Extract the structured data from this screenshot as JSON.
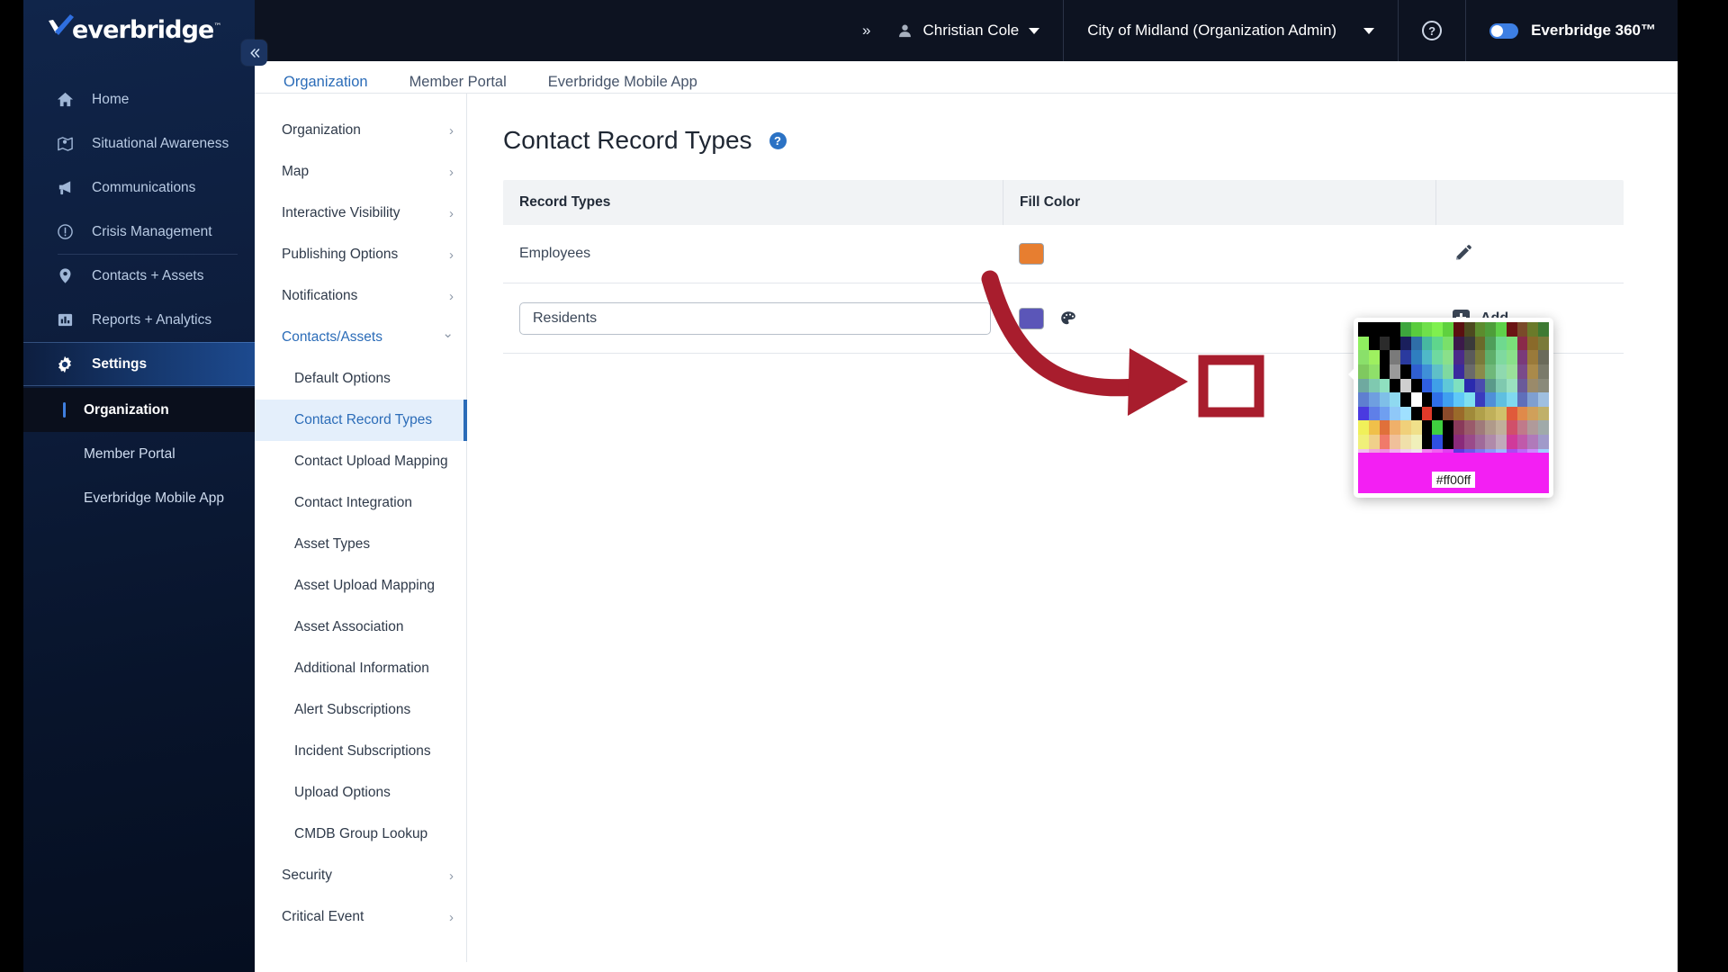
{
  "app": {
    "brand": "everbridge",
    "brand_tm": "™",
    "collapse_icon": "chevron-double-left"
  },
  "topbar": {
    "expand_chevrons": "»",
    "user_name": "Christian Cole",
    "org_name": "City of Midland (Organization Admin)",
    "help_label": "?",
    "product_label": "Everbridge 360™",
    "accent": "#3d7fe3"
  },
  "sidebar": {
    "items": [
      {
        "label": "Home",
        "icon": "home-icon",
        "active": false
      },
      {
        "label": "Situational Awareness",
        "icon": "map-pin-icon",
        "active": false
      },
      {
        "label": "Communications",
        "icon": "megaphone-icon",
        "active": false
      },
      {
        "label": "Crisis Management",
        "icon": "alert-circle-icon",
        "active": false
      },
      {
        "label": "Contacts + Assets",
        "icon": "location-icon",
        "active": false
      },
      {
        "label": "Reports + Analytics",
        "icon": "bar-chart-icon",
        "active": false
      },
      {
        "label": "Settings",
        "icon": "gear-icon",
        "active": true
      }
    ],
    "subitems": [
      {
        "label": "Organization",
        "selected": true
      },
      {
        "label": "Member Portal",
        "selected": false
      },
      {
        "label": "Everbridge Mobile App",
        "selected": false
      }
    ]
  },
  "tabs": [
    {
      "label": "Organization",
      "active": true
    },
    {
      "label": "Member Portal",
      "active": false
    },
    {
      "label": "Everbridge Mobile App",
      "active": false
    }
  ],
  "settings_menu": {
    "groups": [
      {
        "label": "Organization",
        "expandable": true,
        "expanded": false
      },
      {
        "label": "Map",
        "expandable": true,
        "expanded": false
      },
      {
        "label": "Interactive Visibility",
        "expandable": true,
        "expanded": false
      },
      {
        "label": "Publishing Options",
        "expandable": true,
        "expanded": false
      },
      {
        "label": "Notifications",
        "expandable": true,
        "expanded": false
      },
      {
        "label": "Contacts/Assets",
        "expandable": true,
        "expanded": true
      }
    ],
    "contacts_assets_children": [
      {
        "label": "Default Options",
        "selected": false
      },
      {
        "label": "Contact Record Types",
        "selected": true
      },
      {
        "label": "Contact Upload Mapping",
        "selected": false
      },
      {
        "label": "Contact Integration",
        "selected": false
      },
      {
        "label": "Asset Types",
        "selected": false
      },
      {
        "label": "Asset Upload Mapping",
        "selected": false
      },
      {
        "label": "Asset Association",
        "selected": false
      },
      {
        "label": "Additional Information",
        "selected": false
      },
      {
        "label": "Alert Subscriptions",
        "selected": false
      },
      {
        "label": "Incident Subscriptions",
        "selected": false
      },
      {
        "label": "Upload Options",
        "selected": false
      },
      {
        "label": "CMDB Group Lookup",
        "selected": false
      }
    ],
    "tail_groups": [
      {
        "label": "Security",
        "expandable": true,
        "expanded": false
      },
      {
        "label": "Critical Event",
        "expandable": true,
        "expanded": false
      }
    ],
    "chevron_right": "›",
    "chevron_down": "⌄"
  },
  "main": {
    "page_title": "Contact Record Types",
    "help_icon_label": "?",
    "table": {
      "headers": [
        "Record Types",
        "Fill Color",
        ""
      ],
      "rows": [
        {
          "name": "Employees",
          "fill_color": "#e77e30",
          "action": "edit"
        }
      ],
      "new_row": {
        "input_value": "Residents",
        "input_placeholder": "",
        "fill_color": "#5b56b8",
        "add_label": "Add"
      }
    }
  },
  "color_picker": {
    "hex_value": "#ff00ff",
    "selected_color": "#ff00ff",
    "preview_bar_color": "#f31ff3",
    "swatch_columns": 18,
    "swatch_rows": 11,
    "swatches": [
      "#000000",
      "#000000",
      "#000000",
      "#000000",
      "#3da63d",
      "#59cc3d",
      "#6fe04a",
      "#7ff04f",
      "#5fd13f",
      "#5a1010",
      "#4d4a1f",
      "#5c8c2e",
      "#4e9e3a",
      "#5fd14a",
      "#6b1414",
      "#7a4a2a",
      "#6a7a2a",
      "#3e7a33",
      "#8ff05f",
      "#000000",
      "#2b2b2b",
      "#000000",
      "#1a1f5c",
      "#2f6ea8",
      "#47b8a0",
      "#5fd68c",
      "#7ae06a",
      "#3b1a4a",
      "#3a3a3a",
      "#6a6a2a",
      "#4f9e5a",
      "#6fd98f",
      "#7ae07a",
      "#8a2a4a",
      "#8a6a2a",
      "#7a7a3a",
      "#8ae06a",
      "#9ef060",
      "#000000",
      "#7a7a7a",
      "#2a3a9e",
      "#2f7ec0",
      "#4fb8c8",
      "#6fd9a0",
      "#8ae08a",
      "#4a2a8a",
      "#5a5a5a",
      "#7a7a3a",
      "#5fae6a",
      "#7fd99f",
      "#8ae08a",
      "#7a3a7a",
      "#9a7a3a",
      "#6a6a5a",
      "#7fc95f",
      "#8fe06a",
      "#000000",
      "#9a9a9a",
      "#000000",
      "#2f5fd0",
      "#3f8fd8",
      "#5fc0c8",
      "#7fd9a0",
      "#3a2a9e",
      "#6a6a6a",
      "#8a8a4a",
      "#6fb87a",
      "#8fd9af",
      "#9ae09a",
      "#7a4a8a",
      "#aa8a4a",
      "#7a7a6a",
      "#6fa9a0",
      "#7fc9b0",
      "#8fe0c0",
      "#000000",
      "#cfcfcf",
      "#000000",
      "#2f5fe0",
      "#3f9fe8",
      "#5fc8d8",
      "#7fe0c0",
      "#2a2aae",
      "#4a4aae",
      "#5a9a8a",
      "#7fc9af",
      "#9ae0bf",
      "#6a5a9a",
      "#9a8a6a",
      "#8a8a7a",
      "#5f7fd0",
      "#6f9fe0",
      "#7fbfe8",
      "#8fd9f0",
      "#000000",
      "#ffffff",
      "#000000",
      "#2f6fe8",
      "#3f9ff0",
      "#5fc8f8",
      "#7fe0f0",
      "#3a3abe",
      "#4f8fd8",
      "#5fbfe0",
      "#7fd9ef",
      "#5f6fba",
      "#7f9fd0",
      "#9fbfe0",
      "#4a3ae0",
      "#5f7fe8",
      "#6f9ff0",
      "#8fc8f8",
      "#9fe0ff",
      "#000000",
      "#e03a2a",
      "#000000",
      "#8a4a2a",
      "#9a6a2a",
      "#a08a3a",
      "#b0a04a",
      "#c0b05a",
      "#d0c06a",
      "#e05a3a",
      "#e08a4a",
      "#d0a05a",
      "#c0b06a",
      "#f0f05a",
      "#f0c04a",
      "#e0703a",
      "#efb06a",
      "#f0d07a",
      "#f0e08a",
      "#000000",
      "#3fd03f",
      "#000000",
      "#8a3a5a",
      "#9a5a6a",
      "#a07a7a",
      "#b09a8a",
      "#c0b09a",
      "#d0506a",
      "#c07a8a",
      "#b09a9a",
      "#a0aaaa",
      "#f0f07a",
      "#f0d08a",
      "#f07a6a",
      "#f0c09a",
      "#f0e0aa",
      "#f0f0ba",
      "#000000",
      "#2f4fe0",
      "#000000",
      "#8a2a7a",
      "#9a4a8a",
      "#a06a9a",
      "#b08aaa",
      "#c0aaba",
      "#d03a9a",
      "#c05aaa",
      "#b07aba",
      "#a09aca",
      "#f0c0f0",
      "#f0a0e0",
      "#ef8fe0",
      "#f0b0f0",
      "#f0d0f0",
      "#f0e0f0",
      "#f080f0",
      "#f060f0",
      "#e040f0",
      "#5a3ae0",
      "#6a5ae8",
      "#7a7af0",
      "#8a9af8",
      "#9abaff",
      "#aa4af0",
      "#ba6af8",
      "#ca8aff",
      "#9fd0ff",
      "#f060f0",
      "#f040f0",
      "#f020f0",
      "#f000f0",
      "#f030f0",
      "#f050f0",
      "#ff00ff",
      "#f020f0",
      "#f000f0",
      "#7a5af0",
      "#8a7af8",
      "#9a9aff",
      "#aab0ff",
      "#bad0ff",
      "#ca6aff",
      "#da8aff",
      "#eaaaff",
      "#bfe0ff"
    ]
  },
  "annotation": {
    "arrow_color": "#a81d2d",
    "highlight_box_color": "#a81d2d",
    "type": "curved-arrow-pointing-to-selected-swatch"
  }
}
